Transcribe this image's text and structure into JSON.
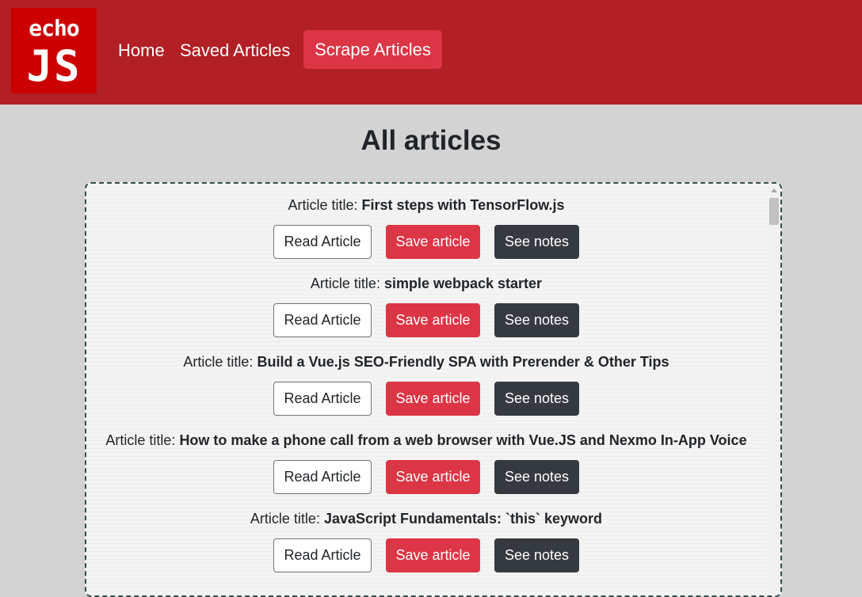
{
  "logo": {
    "line1": "echo",
    "line2": "JS"
  },
  "nav": {
    "home": "Home",
    "saved": "Saved Articles",
    "scrape": "Scrape Articles"
  },
  "page": {
    "title": "All articles"
  },
  "article_prefix": "Article title:",
  "buttons": {
    "read": "Read Article",
    "save": "Save article",
    "notes": "See notes"
  },
  "articles": [
    {
      "title": "First steps with TensorFlow.js"
    },
    {
      "title": "simple webpack starter"
    },
    {
      "title": "Build a Vue.js SEO-Friendly SPA with Prerender & Other Tips"
    },
    {
      "title": "How to make a phone call from a web browser with Vue.JS and Nexmo In-App Voice"
    },
    {
      "title": "JavaScript Fundamentals: `this` keyword"
    }
  ],
  "colors": {
    "navbar": "#b21f24",
    "danger": "#dc3545",
    "dark": "#343a40",
    "background": "#d3d3d3"
  }
}
